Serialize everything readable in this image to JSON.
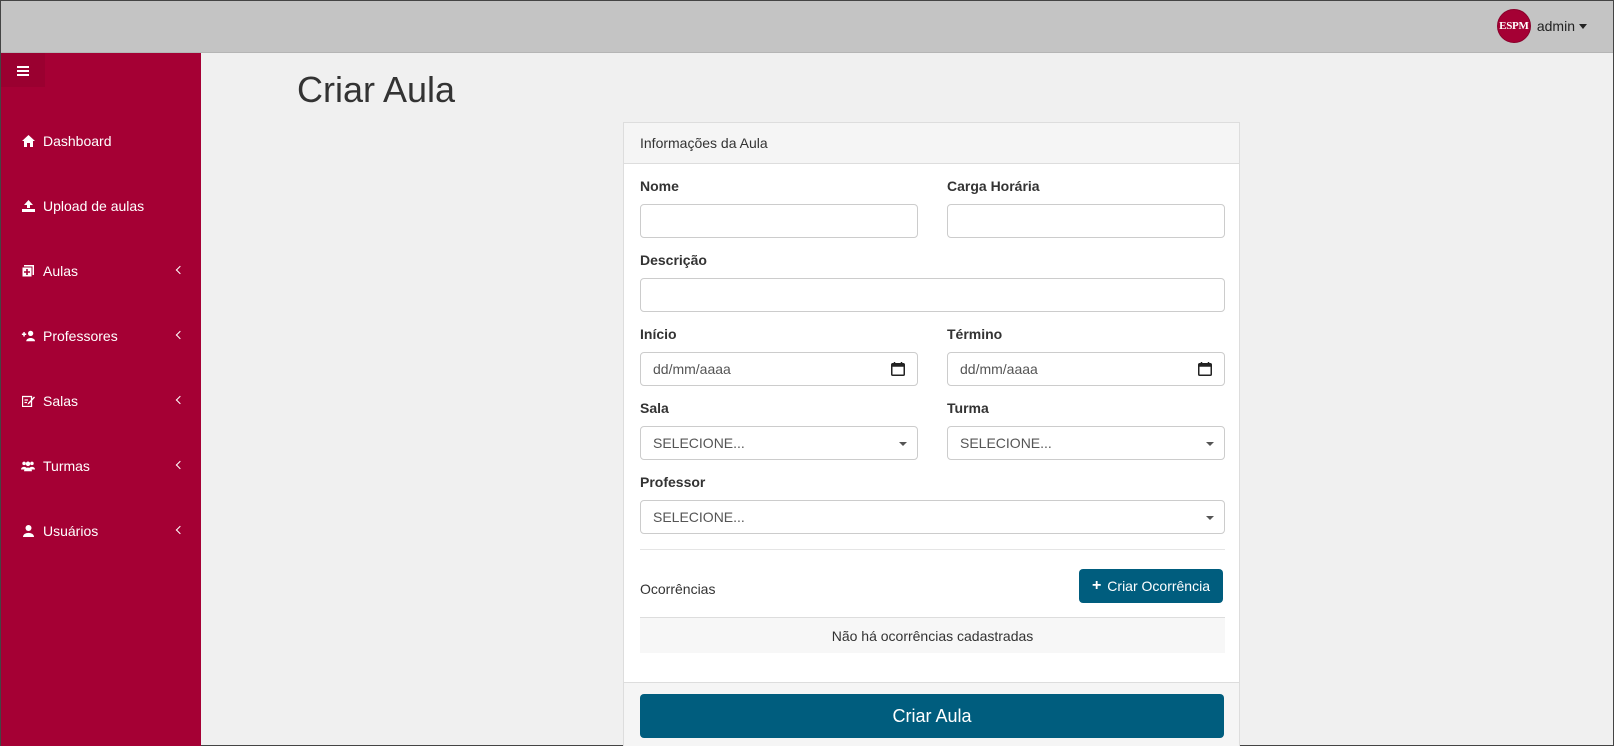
{
  "topbar": {
    "logo_text": "ESPM",
    "user_name": "admin",
    "brand_color": "#a50034"
  },
  "sidebar": {
    "items": [
      {
        "label": "Dashboard",
        "icon": "home-icon",
        "has_submenu": false
      },
      {
        "label": "Upload de aulas",
        "icon": "upload-icon",
        "has_submenu": false
      },
      {
        "label": "Aulas",
        "icon": "plus-square-icon",
        "has_submenu": true
      },
      {
        "label": "Professores",
        "icon": "user-plus-icon",
        "has_submenu": true
      },
      {
        "label": "Salas",
        "icon": "edit-icon",
        "has_submenu": true
      },
      {
        "label": "Turmas",
        "icon": "users-icon",
        "has_submenu": true
      },
      {
        "label": "Usuários",
        "icon": "user-icon",
        "has_submenu": true
      }
    ]
  },
  "main": {
    "title": "Criar Aula",
    "card": {
      "header": "Informações da Aula",
      "fields": {
        "nome": {
          "label": "Nome",
          "value": ""
        },
        "carga_horaria": {
          "label": "Carga Horária",
          "value": ""
        },
        "descricao": {
          "label": "Descrição",
          "value": ""
        },
        "inicio": {
          "label": "Início",
          "placeholder": "dd/mm/aaaa"
        },
        "termino": {
          "label": "Término",
          "placeholder": "dd/mm/aaaa"
        },
        "sala": {
          "label": "Sala",
          "selected": "SELECIONE..."
        },
        "turma": {
          "label": "Turma",
          "selected": "SELECIONE..."
        },
        "professor": {
          "label": "Professor",
          "selected": "SELECIONE..."
        }
      },
      "ocorrencias": {
        "label": "Ocorrências",
        "add_button": "Criar Ocorrência",
        "empty_text": "Não há ocorrências cadastradas"
      },
      "submit_button": "Criar Aula"
    }
  },
  "colors": {
    "primary_button": "#005d7e",
    "sidebar": "#a50034",
    "topbar": "#c4c4c4"
  }
}
